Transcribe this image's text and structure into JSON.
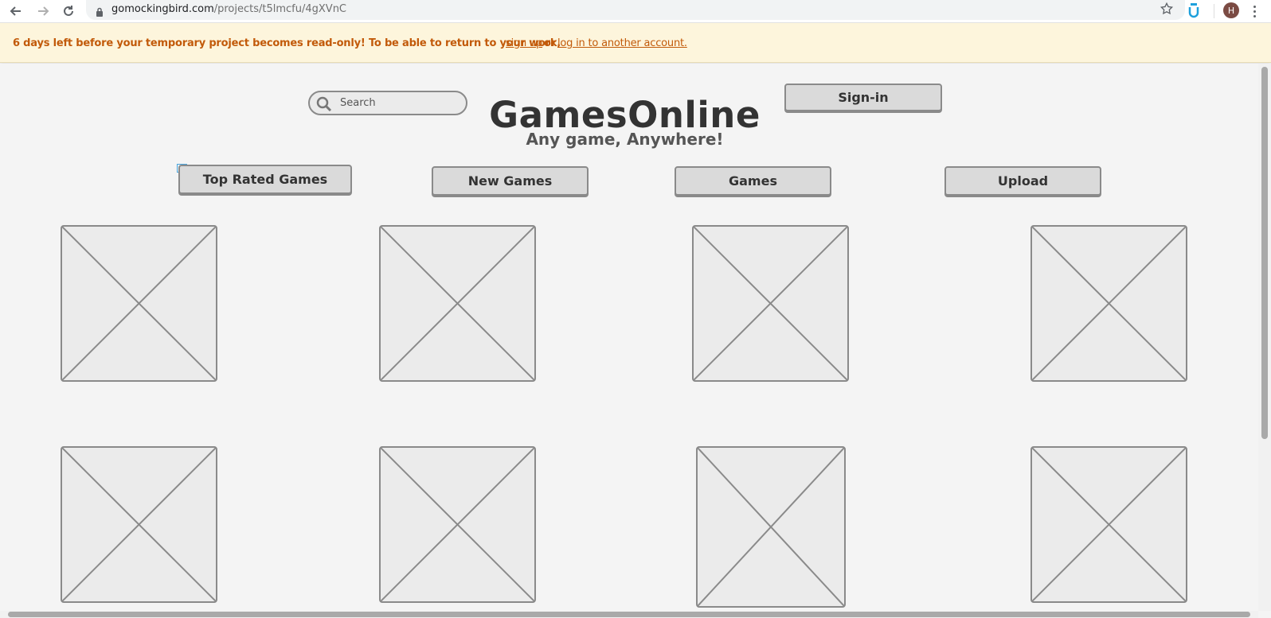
{
  "browser": {
    "url_domain": "gomockingbird.com",
    "url_path": "/projects/t5lmcfu/4gXVnC",
    "avatar_initial": "H",
    "icons": [
      "back-icon",
      "forward-icon",
      "reload-icon",
      "lock-icon",
      "star-icon",
      "extension-icon",
      "menu-icon"
    ]
  },
  "banner": {
    "message": "6 days left before your temporary project becomes read-only! To be able to return to your work,",
    "signup_link": "sign up",
    "or_text": "or",
    "login_link": "log in to another account."
  },
  "header": {
    "search_placeholder": "Search",
    "title": "GamesOnline",
    "subtitle": "Any game, Anywhere!",
    "signin_label": "Sign-in"
  },
  "nav": {
    "top_rated": "Top Rated Games",
    "new_games": "New Games",
    "games": "Games",
    "upload": "Upload"
  },
  "colors": {
    "banner_bg": "#fdf5dc",
    "banner_text": "#c25a0a",
    "widget_border": "#8a8a8a",
    "widget_fill": "#dadada",
    "canvas_bg": "#f4f4f4"
  }
}
